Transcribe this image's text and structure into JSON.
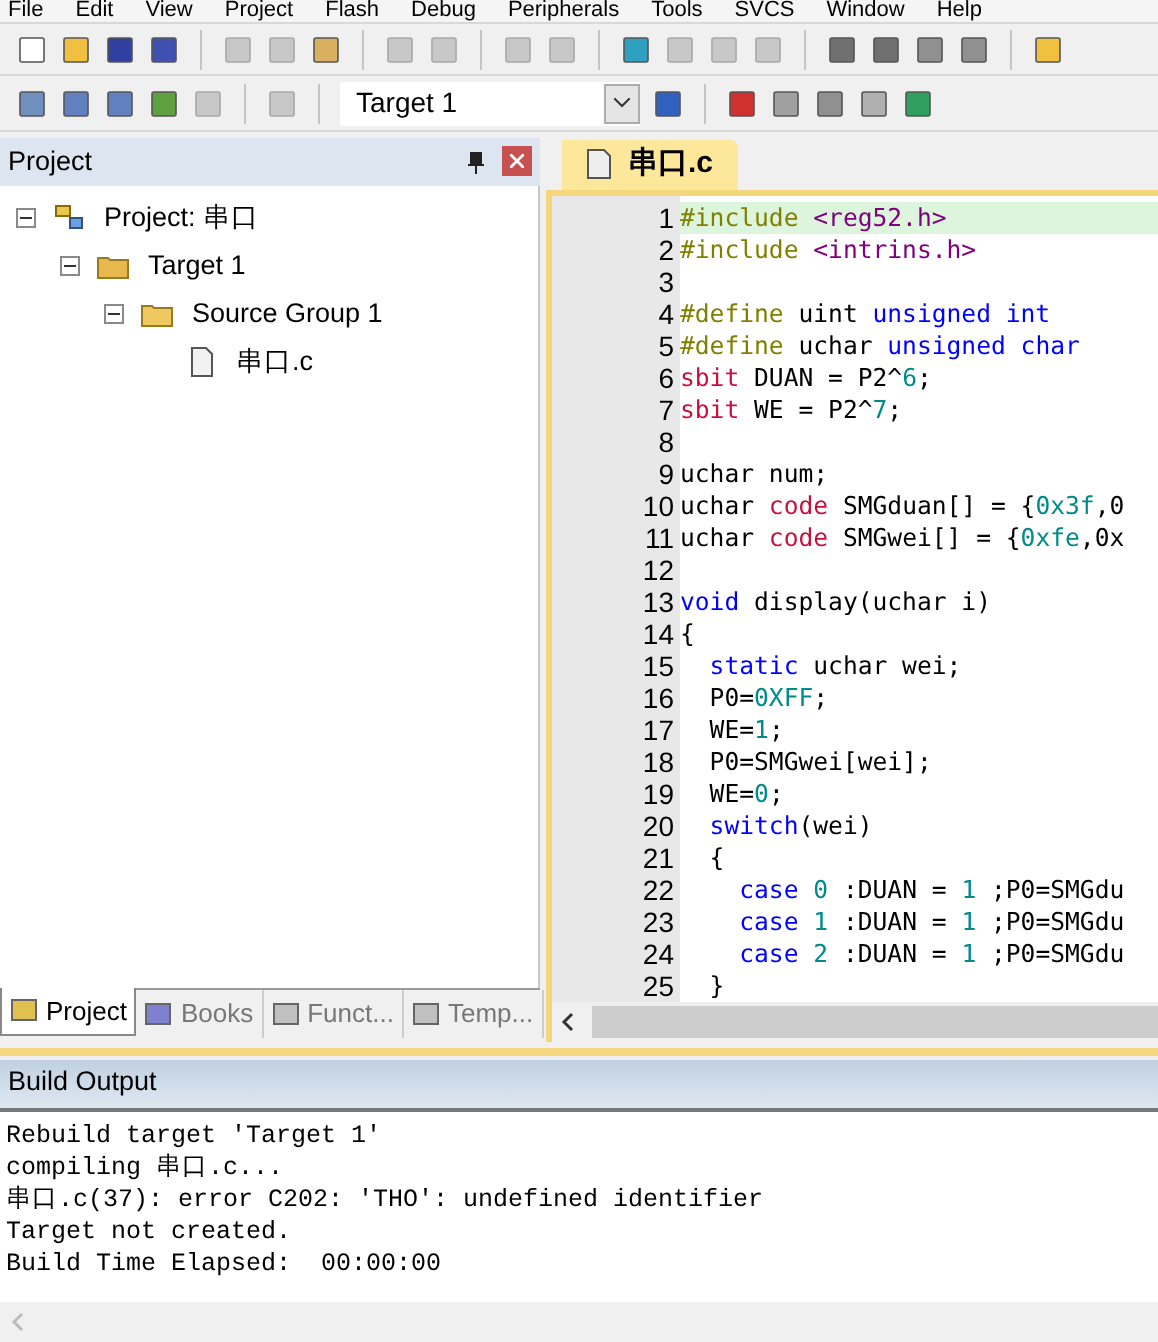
{
  "menu": [
    "File",
    "Edit",
    "View",
    "Project",
    "Flash",
    "Debug",
    "Peripherals",
    "Tools",
    "SVCS",
    "Window",
    "Help"
  ],
  "target_select": {
    "value": "Target 1"
  },
  "project_panel": {
    "title": "Project",
    "tree": [
      {
        "label": "Project: 串口",
        "kind": "project",
        "expanded": true,
        "children": [
          {
            "label": "Target 1",
            "kind": "target",
            "expanded": true,
            "children": [
              {
                "label": "Source Group 1",
                "kind": "group",
                "expanded": true,
                "children": [
                  {
                    "label": "串口.c",
                    "kind": "file"
                  }
                ]
              }
            ]
          }
        ]
      }
    ],
    "tabs": [
      {
        "label": "Project",
        "selected": true
      },
      {
        "label": "Books",
        "selected": false
      },
      {
        "label": "Funct...",
        "selected": false
      },
      {
        "label": "Temp...",
        "selected": false
      }
    ]
  },
  "editor": {
    "tabs": [
      {
        "label": "串口.c",
        "selected": true
      }
    ],
    "lines": [
      {
        "number": "1",
        "current": true,
        "tokens": [
          {
            "kind": "pp",
            "text": "#include"
          },
          {
            "kind": "header",
            "text": " <reg52.h>"
          }
        ]
      },
      {
        "number": "2",
        "current": false,
        "tokens": [
          {
            "kind": "pp",
            "text": "#include"
          },
          {
            "kind": "header",
            "text": " <intrins.h>"
          }
        ]
      },
      {
        "number": "3",
        "current": false
      },
      {
        "number": "4",
        "current": false,
        "tokens": [
          {
            "kind": "pp",
            "text": "#define"
          },
          {
            "kind": "plain",
            "text": " uint "
          },
          {
            "kind": "keyword",
            "text": "unsigned int"
          }
        ]
      },
      {
        "number": "5",
        "current": false,
        "tokens": [
          {
            "kind": "pp",
            "text": "#define"
          },
          {
            "kind": "plain",
            "text": " uchar "
          },
          {
            "kind": "keyword",
            "text": "unsigned char"
          }
        ]
      },
      {
        "number": "6",
        "current": false,
        "tokens": [
          {
            "kind": "keyword2",
            "text": "sbit"
          },
          {
            "kind": "plain",
            "text": " DUAN = P2^"
          },
          {
            "kind": "number",
            "text": "6"
          },
          {
            "kind": "plain",
            "text": ";"
          }
        ]
      },
      {
        "number": "7",
        "current": false,
        "tokens": [
          {
            "kind": "keyword2",
            "text": "sbit"
          },
          {
            "kind": "plain",
            "text": " WE = P2^"
          },
          {
            "kind": "number",
            "text": "7"
          },
          {
            "kind": "plain",
            "text": ";"
          }
        ]
      },
      {
        "number": "8",
        "current": false
      },
      {
        "number": "9",
        "current": false,
        "tokens": [
          {
            "kind": "plain",
            "text": "uchar num;"
          }
        ]
      },
      {
        "number": "10",
        "current": false,
        "tokens": [
          {
            "kind": "plain",
            "text": "uchar "
          },
          {
            "kind": "keyword2",
            "text": "code"
          },
          {
            "kind": "plain",
            "text": " SMGduan[] = {"
          },
          {
            "kind": "number",
            "text": "0x3f"
          },
          {
            "kind": "plain",
            "text": ",0"
          }
        ]
      },
      {
        "number": "11",
        "current": false,
        "tokens": [
          {
            "kind": "plain",
            "text": "uchar "
          },
          {
            "kind": "keyword2",
            "text": "code"
          },
          {
            "kind": "plain",
            "text": " SMGwei[] = {"
          },
          {
            "kind": "number",
            "text": "0xfe"
          },
          {
            "kind": "plain",
            "text": ",0x"
          }
        ]
      },
      {
        "number": "12",
        "current": false
      },
      {
        "number": "13",
        "current": false,
        "tokens": [
          {
            "kind": "keyword",
            "text": "void"
          },
          {
            "kind": "plain",
            "text": " display(uchar i)"
          }
        ]
      },
      {
        "number": "14",
        "current": false,
        "tokens": [
          {
            "kind": "plain",
            "text": "{"
          }
        ]
      },
      {
        "number": "15",
        "current": false,
        "tokens": [
          {
            "kind": "keyword",
            "text": "  static"
          },
          {
            "kind": "plain",
            "text": " uchar wei;"
          }
        ]
      },
      {
        "number": "16",
        "current": false,
        "tokens": [
          {
            "kind": "plain",
            "text": "  P0="
          },
          {
            "kind": "number",
            "text": "0XFF"
          },
          {
            "kind": "plain",
            "text": ";"
          }
        ]
      },
      {
        "number": "17",
        "current": false,
        "tokens": [
          {
            "kind": "plain",
            "text": "  WE="
          },
          {
            "kind": "number",
            "text": "1"
          },
          {
            "kind": "plain",
            "text": ";"
          }
        ]
      },
      {
        "number": "18",
        "current": false,
        "tokens": [
          {
            "kind": "plain",
            "text": "  P0=SMGwei[wei];"
          }
        ]
      },
      {
        "number": "19",
        "current": false,
        "tokens": [
          {
            "kind": "plain",
            "text": "  WE="
          },
          {
            "kind": "number",
            "text": "0"
          },
          {
            "kind": "plain",
            "text": ";"
          }
        ]
      },
      {
        "number": "20",
        "current": false,
        "tokens": [
          {
            "kind": "keyword",
            "text": "  switch"
          },
          {
            "kind": "plain",
            "text": "(wei)"
          }
        ]
      },
      {
        "number": "21",
        "current": false,
        "tokens": [
          {
            "kind": "plain",
            "text": "  {"
          }
        ]
      },
      {
        "number": "22",
        "current": false,
        "tokens": [
          {
            "kind": "keyword",
            "text": "    case"
          },
          {
            "kind": "number",
            "text": " 0"
          },
          {
            "kind": "plain",
            "text": " :DUAN = "
          },
          {
            "kind": "number",
            "text": "1"
          },
          {
            "kind": "plain",
            "text": " ;P0=SMGdu"
          }
        ]
      },
      {
        "number": "23",
        "current": false,
        "tokens": [
          {
            "kind": "keyword",
            "text": "    case"
          },
          {
            "kind": "number",
            "text": " 1"
          },
          {
            "kind": "plain",
            "text": " :DUAN = "
          },
          {
            "kind": "number",
            "text": "1"
          },
          {
            "kind": "plain",
            "text": " ;P0=SMGdu"
          }
        ]
      },
      {
        "number": "24",
        "current": false,
        "tokens": [
          {
            "kind": "keyword",
            "text": "    case"
          },
          {
            "kind": "number",
            "text": " 2"
          },
          {
            "kind": "plain",
            "text": " :DUAN = "
          },
          {
            "kind": "number",
            "text": "1"
          },
          {
            "kind": "plain",
            "text": " ;P0=SMGdu"
          }
        ]
      },
      {
        "number": "25",
        "current": false,
        "tokens": [
          {
            "kind": "plain",
            "text": "  }"
          }
        ]
      }
    ]
  },
  "build_output": {
    "title": "Build Output",
    "lines": [
      "Rebuild target 'Target 1'",
      "compiling 串口.c...",
      "串口.c(37): error C202: 'THO': undefined identifier",
      "Target not created.",
      "Build Time Elapsed:  00:00:00"
    ]
  }
}
